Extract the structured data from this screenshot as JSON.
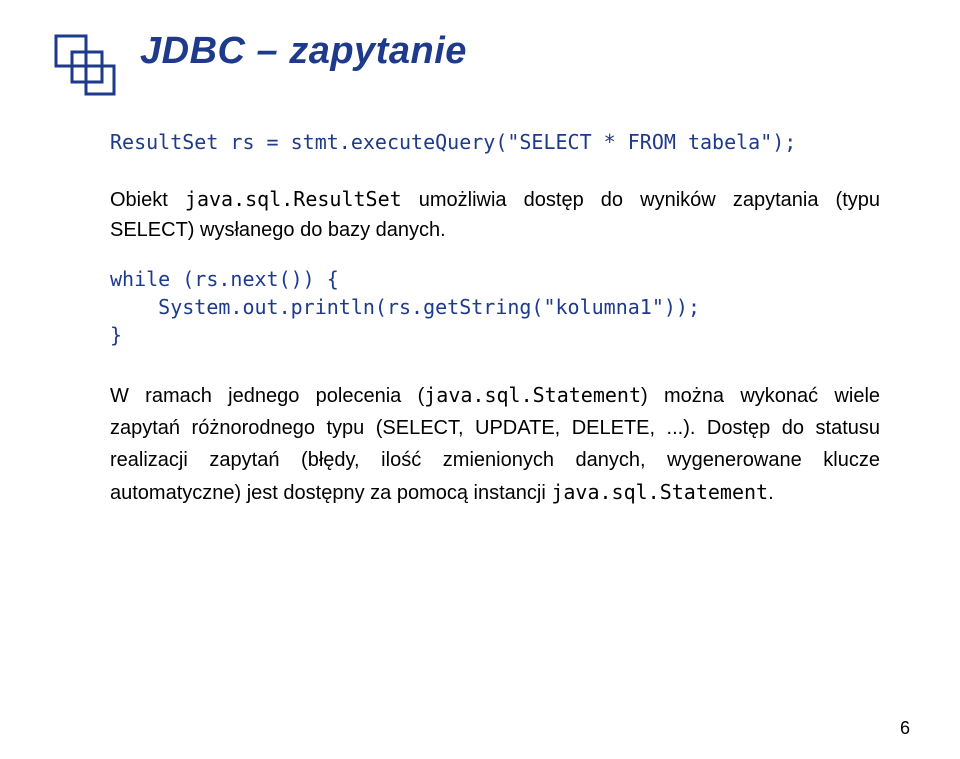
{
  "title": "JDBC – zapytanie",
  "code1": "ResultSet rs = stmt.executeQuery(\"SELECT * FROM tabela\");",
  "body1_pre": "Obiekt ",
  "body1_mono": "java.sql.ResultSet",
  "body1_post": " umożliwia dostęp do wyników zapytania (typu SELECT) wysłanego do bazy danych.",
  "code2": "while (rs.next()) {\n    System.out.println(rs.getString(\"kolumna1\"));\n}",
  "body2_pre": "W ramach jednego polecenia (",
  "body2_mono1": "java.sql.Statement",
  "body2_mid": ") można wykonać wiele zapytań różnorodnego typu (SELECT, UPDATE, DELETE, ...). Dostęp do statusu realizacji zapytań (błędy, ilość zmienionych danych, wygenerowane klucze automatyczne) jest dostępny za pomocą instancji ",
  "body2_mono2": "java.sql.Statement",
  "body2_post": ".",
  "pagenum": "6"
}
